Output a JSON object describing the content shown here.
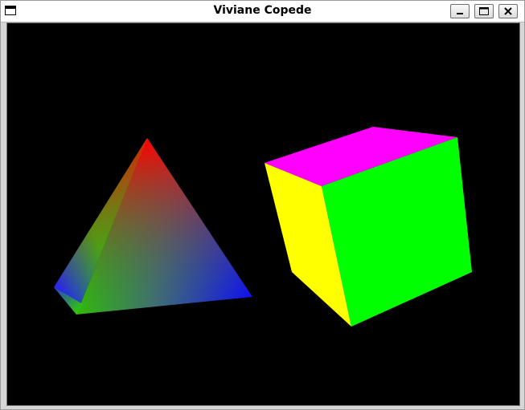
{
  "window": {
    "title": "Viviane Copede",
    "system_icon": "window-menu-icon",
    "controls": [
      {
        "name": "minimize",
        "icon": "minimize-icon"
      },
      {
        "name": "maximize",
        "icon": "maximize-icon"
      },
      {
        "name": "close",
        "icon": "close-icon"
      }
    ]
  },
  "scene": {
    "background": "#000000",
    "objects": [
      {
        "name": "pyramid",
        "colors": [
          "#ff0000",
          "#00ff00",
          "#0000ff"
        ]
      },
      {
        "name": "cube",
        "faces": {
          "top": "#ff00ff",
          "front": "#00ff00",
          "left": "#ffff00"
        }
      }
    ]
  }
}
